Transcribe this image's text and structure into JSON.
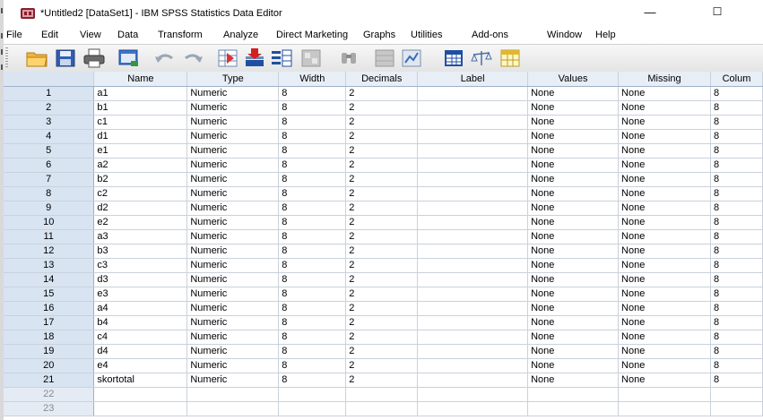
{
  "window": {
    "title": "*Untitled2 [DataSet1] - IBM SPSS Statistics Data Editor",
    "minimize_glyph": "—",
    "maximize_glyph": "☐"
  },
  "menu": [
    {
      "label": "File"
    },
    {
      "label": "Edit"
    },
    {
      "label": "View"
    },
    {
      "label": "Data"
    },
    {
      "label": "Transform"
    },
    {
      "label": "Analyze"
    },
    {
      "label": "Direct Marketing"
    },
    {
      "label": "Graphs"
    },
    {
      "label": "Utilities"
    },
    {
      "label": "Add-ons"
    },
    {
      "label": "Window"
    },
    {
      "label": "Help"
    }
  ],
  "toolbar": [
    {
      "icon": "open-folder-icon"
    },
    {
      "icon": "save-icon"
    },
    {
      "icon": "print-icon"
    },
    {
      "icon": "dialog-recall-icon"
    },
    {
      "icon": "undo-icon"
    },
    {
      "icon": "redo-icon"
    },
    {
      "icon": "goto-case-icon"
    },
    {
      "icon": "goto-variable-icon"
    },
    {
      "icon": "variables-icon"
    },
    {
      "icon": "run-descriptives-icon"
    },
    {
      "icon": "find-icon"
    },
    {
      "icon": "insert-cases-icon"
    },
    {
      "icon": "insert-variable-icon"
    },
    {
      "icon": "split-file-icon"
    },
    {
      "icon": "weight-cases-icon"
    },
    {
      "icon": "select-cases-icon"
    }
  ],
  "columns": [
    "Name",
    "Type",
    "Width",
    "Decimals",
    "Label",
    "Values",
    "Missing",
    "Colum"
  ],
  "variables": [
    {
      "row": "1",
      "name": "a1",
      "type": "Numeric",
      "width": "8",
      "decimals": "2",
      "label": "",
      "values": "None",
      "missing": "None",
      "columns": "8"
    },
    {
      "row": "2",
      "name": "b1",
      "type": "Numeric",
      "width": "8",
      "decimals": "2",
      "label": "",
      "values": "None",
      "missing": "None",
      "columns": "8"
    },
    {
      "row": "3",
      "name": "c1",
      "type": "Numeric",
      "width": "8",
      "decimals": "2",
      "label": "",
      "values": "None",
      "missing": "None",
      "columns": "8"
    },
    {
      "row": "4",
      "name": "d1",
      "type": "Numeric",
      "width": "8",
      "decimals": "2",
      "label": "",
      "values": "None",
      "missing": "None",
      "columns": "8"
    },
    {
      "row": "5",
      "name": "e1",
      "type": "Numeric",
      "width": "8",
      "decimals": "2",
      "label": "",
      "values": "None",
      "missing": "None",
      "columns": "8"
    },
    {
      "row": "6",
      "name": "a2",
      "type": "Numeric",
      "width": "8",
      "decimals": "2",
      "label": "",
      "values": "None",
      "missing": "None",
      "columns": "8"
    },
    {
      "row": "7",
      "name": "b2",
      "type": "Numeric",
      "width": "8",
      "decimals": "2",
      "label": "",
      "values": "None",
      "missing": "None",
      "columns": "8"
    },
    {
      "row": "8",
      "name": "c2",
      "type": "Numeric",
      "width": "8",
      "decimals": "2",
      "label": "",
      "values": "None",
      "missing": "None",
      "columns": "8"
    },
    {
      "row": "9",
      "name": "d2",
      "type": "Numeric",
      "width": "8",
      "decimals": "2",
      "label": "",
      "values": "None",
      "missing": "None",
      "columns": "8"
    },
    {
      "row": "10",
      "name": "e2",
      "type": "Numeric",
      "width": "8",
      "decimals": "2",
      "label": "",
      "values": "None",
      "missing": "None",
      "columns": "8"
    },
    {
      "row": "11",
      "name": "a3",
      "type": "Numeric",
      "width": "8",
      "decimals": "2",
      "label": "",
      "values": "None",
      "missing": "None",
      "columns": "8"
    },
    {
      "row": "12",
      "name": "b3",
      "type": "Numeric",
      "width": "8",
      "decimals": "2",
      "label": "",
      "values": "None",
      "missing": "None",
      "columns": "8"
    },
    {
      "row": "13",
      "name": "c3",
      "type": "Numeric",
      "width": "8",
      "decimals": "2",
      "label": "",
      "values": "None",
      "missing": "None",
      "columns": "8"
    },
    {
      "row": "14",
      "name": "d3",
      "type": "Numeric",
      "width": "8",
      "decimals": "2",
      "label": "",
      "values": "None",
      "missing": "None",
      "columns": "8"
    },
    {
      "row": "15",
      "name": "e3",
      "type": "Numeric",
      "width": "8",
      "decimals": "2",
      "label": "",
      "values": "None",
      "missing": "None",
      "columns": "8"
    },
    {
      "row": "16",
      "name": "a4",
      "type": "Numeric",
      "width": "8",
      "decimals": "2",
      "label": "",
      "values": "None",
      "missing": "None",
      "columns": "8"
    },
    {
      "row": "17",
      "name": "b4",
      "type": "Numeric",
      "width": "8",
      "decimals": "2",
      "label": "",
      "values": "None",
      "missing": "None",
      "columns": "8"
    },
    {
      "row": "18",
      "name": "c4",
      "type": "Numeric",
      "width": "8",
      "decimals": "2",
      "label": "",
      "values": "None",
      "missing": "None",
      "columns": "8"
    },
    {
      "row": "19",
      "name": "d4",
      "type": "Numeric",
      "width": "8",
      "decimals": "2",
      "label": "",
      "values": "None",
      "missing": "None",
      "columns": "8"
    },
    {
      "row": "20",
      "name": "e4",
      "type": "Numeric",
      "width": "8",
      "decimals": "2",
      "label": "",
      "values": "None",
      "missing": "None",
      "columns": "8"
    },
    {
      "row": "21",
      "name": "skortotal",
      "type": "Numeric",
      "width": "8",
      "decimals": "2",
      "label": "",
      "values": "None",
      "missing": "None",
      "columns": "8"
    },
    {
      "row": "22",
      "name": "",
      "type": "",
      "width": "",
      "decimals": "",
      "label": "",
      "values": "",
      "missing": "",
      "columns": ""
    },
    {
      "row": "23",
      "name": "",
      "type": "",
      "width": "",
      "decimals": "",
      "label": "",
      "values": "",
      "missing": "",
      "columns": ""
    }
  ]
}
